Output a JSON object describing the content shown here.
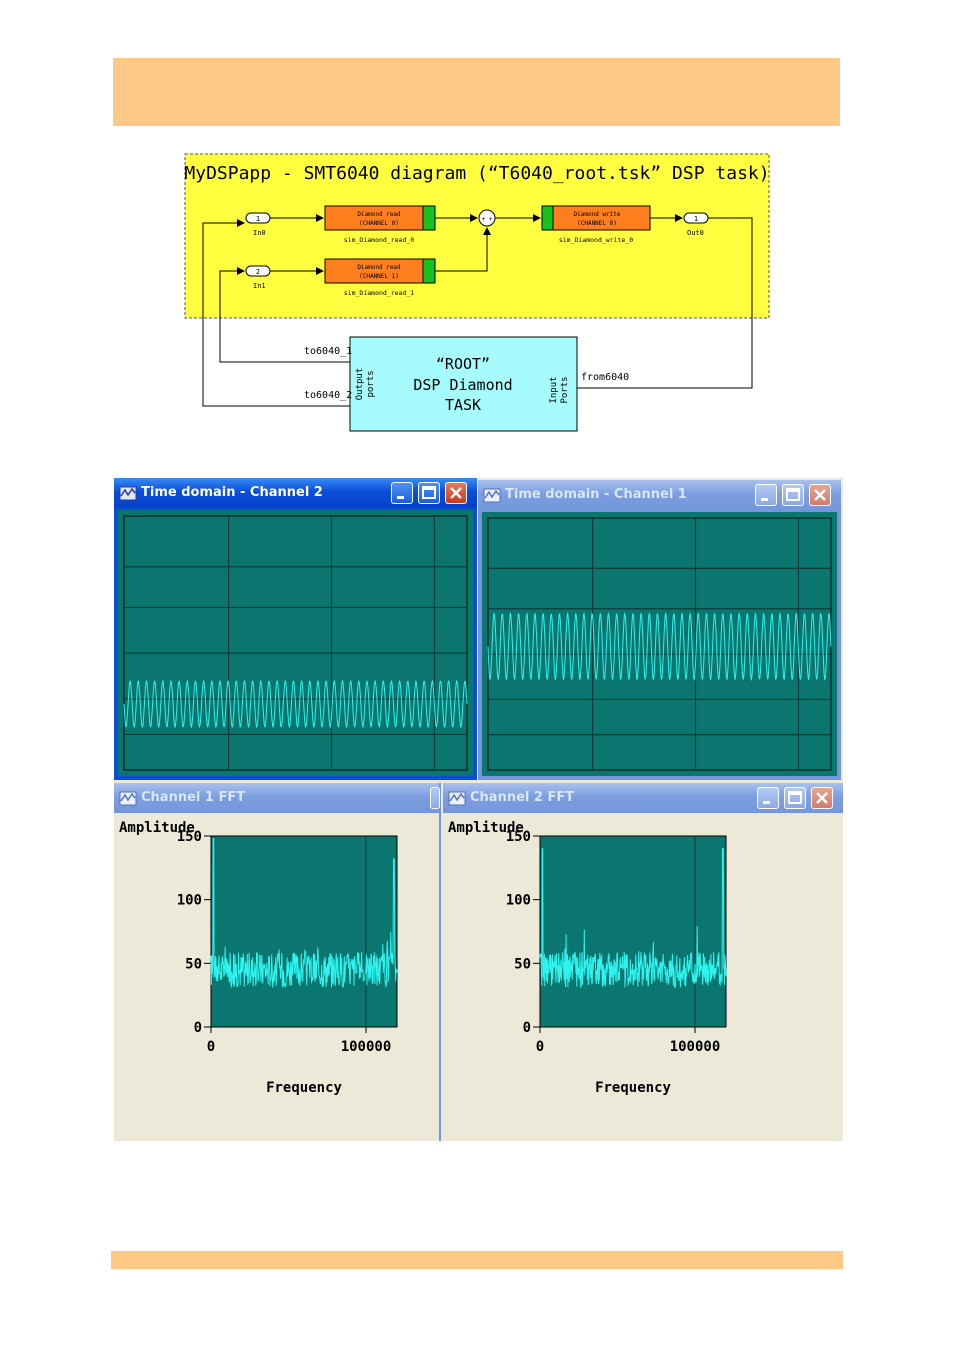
{
  "colors": {
    "band": "#fdc985",
    "diagram_bg": "#ffff40",
    "block": "#ff7f1f",
    "root_box": "#a6fcfd",
    "plot_bg": "#0b766f",
    "trace": "#2ef3ee",
    "xp_blue": "#0a4ed8"
  },
  "diagram": {
    "title": "MyDSPapp - SMT6040 diagram (“T6040_root.tsk” DSP task)",
    "inports": [
      {
        "num": "1",
        "label": "In0"
      },
      {
        "num": "2",
        "label": "In1"
      }
    ],
    "outport": {
      "num": "1",
      "label": "Out0"
    },
    "blocks": [
      {
        "line1": "Diamond read",
        "line2": "(CHANNEL 0)",
        "caption": "sim_Diamond_read_0"
      },
      {
        "line1": "Diamond read",
        "line2": "(CHANNEL 1)",
        "caption": "sim_Diamond_read_1"
      },
      {
        "line1": "Diamond write",
        "line2": "(CHANNEL 0)",
        "caption": "sim_Diamond_write_0"
      }
    ],
    "sum_signs": "+ +",
    "root_task": {
      "line1": "“ROOT”",
      "line2": "DSP Diamond",
      "line3": "TASK",
      "output_ports_l1": "Output",
      "output_ports_l2": "ports",
      "input_ports_l1": "Input",
      "input_ports_l2": "Ports"
    },
    "signals": {
      "to1": "to6040_1",
      "to2": "to6040_2",
      "from": "from6040"
    }
  },
  "windows": {
    "time_ch2": {
      "title": "Time domain - Channel 2",
      "icon": "scope-icon",
      "active": true
    },
    "time_ch1": {
      "title": "Time domain - Channel 1",
      "icon": "scope-icon",
      "active": false
    },
    "fft_ch1": {
      "title": "Channel 1 FFT",
      "icon": "scope-icon",
      "active": false
    },
    "fft_ch2": {
      "title": "Channel 2 FFT",
      "icon": "scope-icon",
      "active": false
    }
  },
  "chart_data": [
    {
      "type": "line",
      "title": "Time domain - Channel 2",
      "description_visible": "sinusoid",
      "cycles": 42,
      "center": 0.74,
      "amplitude": 0.09,
      "grid": true
    },
    {
      "type": "line",
      "title": "Time domain - Channel 1",
      "description_visible": "sinusoid",
      "cycles": 42,
      "center": 0.51,
      "amplitude": 0.13,
      "grid": true
    },
    {
      "type": "line",
      "title": "Channel 1 FFT",
      "ylabel": "Amplitude",
      "xlabel": "Frequency",
      "yticks": [
        "150",
        "100",
        "50",
        "0"
      ],
      "xticks": [
        "0",
        "100000"
      ],
      "ylim": [
        0,
        150
      ],
      "xlim": [
        0,
        120000
      ],
      "noise_floor": 45,
      "peaks": [
        {
          "x": 1500,
          "y": 148
        },
        {
          "x": 118000,
          "y": 132
        }
      ]
    },
    {
      "type": "line",
      "title": "Channel 2 FFT",
      "ylabel": "Amplitude",
      "xlabel": "Frequency",
      "yticks": [
        "150",
        "100",
        "50",
        "0"
      ],
      "xticks": [
        "0",
        "100000"
      ],
      "ylim": [
        0,
        150
      ],
      "xlim": [
        0,
        120000
      ],
      "noise_floor": 45,
      "peaks": [
        {
          "x": 1500,
          "y": 140
        },
        {
          "x": 118000,
          "y": 140
        }
      ]
    }
  ]
}
